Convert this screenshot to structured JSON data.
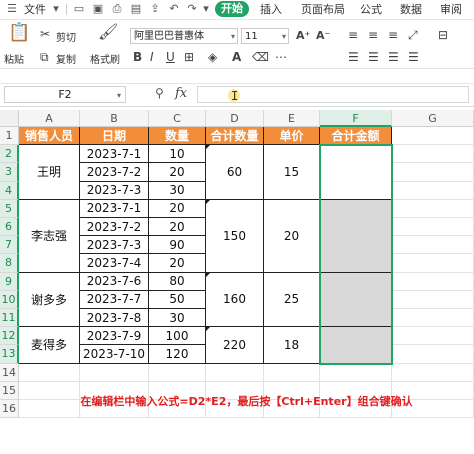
{
  "menubar": {
    "file_label": "文件",
    "tabs": [
      "开始",
      "插入",
      "页面布局",
      "公式",
      "数据",
      "审阅"
    ],
    "active_tab": "开始"
  },
  "ribbon": {
    "paste_label": "粘贴",
    "cut_label": "剪切",
    "copy_label": "复制",
    "format_painter_label": "格式刷",
    "font_name": "阿里巴巴普惠体",
    "font_size": "11"
  },
  "formula_bar": {
    "name_box": "F2",
    "fx_label": "fx",
    "formula": ""
  },
  "columns": [
    "A",
    "B",
    "C",
    "D",
    "E",
    "F",
    "G"
  ],
  "rows": [
    "1",
    "2",
    "3",
    "4",
    "5",
    "6",
    "7",
    "8",
    "9",
    "10",
    "11",
    "12",
    "13",
    "14",
    "15",
    "16"
  ],
  "headers": {
    "salesperson": "销售人员",
    "date": "日期",
    "quantity": "数量",
    "total_quantity": "合计数量",
    "unit_price": "单价",
    "total_amount": "合计金额"
  },
  "groups": [
    {
      "name": "王明",
      "total_qty": "60",
      "price": "15",
      "rows": [
        {
          "date": "2023-7-1",
          "qty": "10"
        },
        {
          "date": "2023-7-2",
          "qty": "20"
        },
        {
          "date": "2023-7-3",
          "qty": "30"
        }
      ]
    },
    {
      "name": "李志强",
      "total_qty": "150",
      "price": "20",
      "rows": [
        {
          "date": "2023-7-1",
          "qty": "20"
        },
        {
          "date": "2023-7-2",
          "qty": "20"
        },
        {
          "date": "2023-7-3",
          "qty": "90"
        },
        {
          "date": "2023-7-4",
          "qty": "20"
        }
      ]
    },
    {
      "name": "谢多多",
      "total_qty": "160",
      "price": "25",
      "rows": [
        {
          "date": "2023-7-6",
          "qty": "80"
        },
        {
          "date": "2023-7-7",
          "qty": "50"
        },
        {
          "date": "2023-7-8",
          "qty": "30"
        }
      ]
    },
    {
      "name": "麦得多",
      "total_qty": "220",
      "price": "18",
      "rows": [
        {
          "date": "2023-7-9",
          "qty": "100"
        },
        {
          "date": "2023-7-10",
          "qty": "120"
        }
      ]
    }
  ],
  "instruction": "在编辑栏中输入公式=D2*E2，最后按【Ctrl+Enter】组合键确认",
  "colors": {
    "accent": "#21a366",
    "header_fill": "#f28d3a",
    "selected_fill": "#d9d9d9",
    "note": "#e02020"
  }
}
